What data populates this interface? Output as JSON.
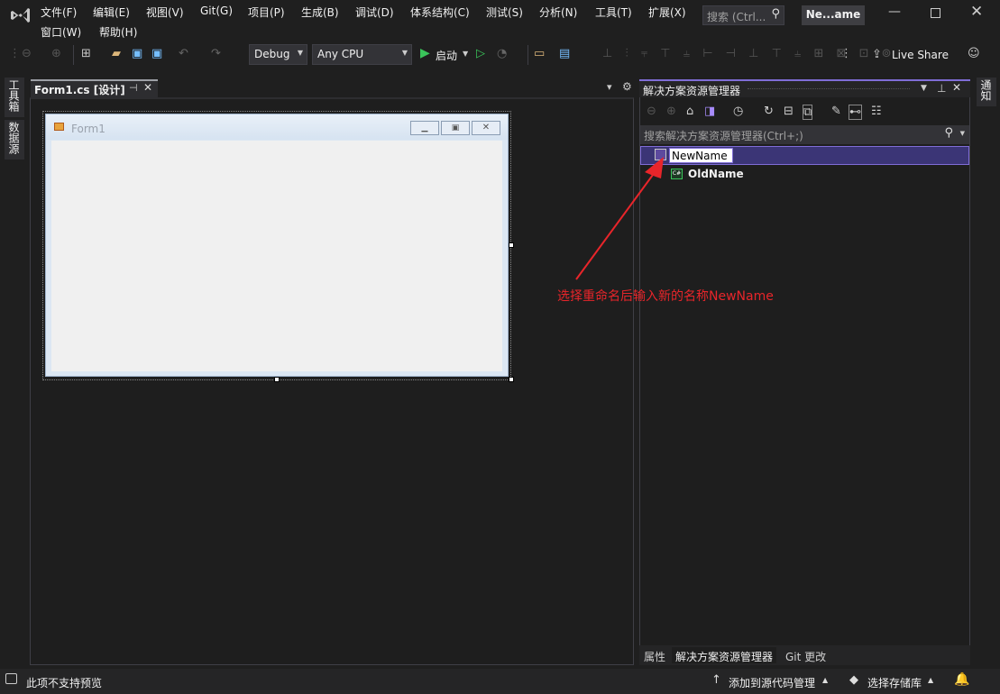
{
  "menu": {
    "file": "文件(F)",
    "edit": "编辑(E)",
    "view": "视图(V)",
    "git": "Git(G)",
    "project": "项目(P)",
    "build": "生成(B)",
    "debug": "调试(D)",
    "arch": "体系结构(C)",
    "test": "测试(S)",
    "analyze": "分析(N)",
    "tools": "工具(T)",
    "extensions": "扩展(X)",
    "window": "窗口(W)",
    "help": "帮助(H)"
  },
  "search": {
    "placeholder": "搜索 (Ctrl..."
  },
  "title_badge": "Ne...ame",
  "toolbar": {
    "config": "Debug",
    "platform": "Any CPU",
    "start": "启动",
    "live_share": "Live Share"
  },
  "side_tabs": {
    "toolbox": "工具箱",
    "datasource": "数据源",
    "notify": "通知"
  },
  "editor": {
    "tab_title": "Form1.cs [设计]",
    "pin": "⊣",
    "close": "✕",
    "menu": "▾",
    "gear": "⚙"
  },
  "form": {
    "title": "Form1"
  },
  "solution_explorer": {
    "title": "解决方案资源管理器",
    "search_placeholder": "搜索解决方案资源管理器(Ctrl+;)",
    "rename_value": "NewName",
    "project_name": "OldName",
    "project_badge": "C#"
  },
  "annotation": {
    "text": "选择重命名后输入新的名称NewName",
    "color": "#e8252a"
  },
  "bottom_tabs": {
    "properties": "属性",
    "solution": "解决方案资源管理器",
    "git": "Git 更改"
  },
  "status": {
    "message": "此项不支持预览",
    "add_source": "添加到源代码管理",
    "select_repo": "选择存储库"
  },
  "colors": {
    "accent": "#3f3fa0",
    "selection": "#3b3576",
    "status_bar": "#252526"
  }
}
